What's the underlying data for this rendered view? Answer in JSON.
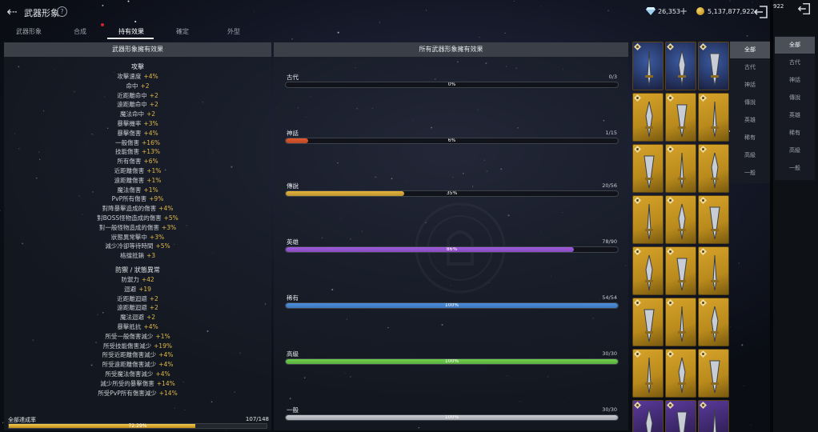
{
  "header": {
    "title": "武器形象",
    "help_icon": "?",
    "back_icon": "back-arrow-icon",
    "gems": "26,353",
    "gem_plus": "+",
    "gold": "5,137,877,922",
    "top_right_number": "922"
  },
  "tabs": [
    {
      "label": "武器形象"
    },
    {
      "label": "合成"
    },
    {
      "label": "持有效果"
    },
    {
      "label": "確定"
    },
    {
      "label": "外型"
    }
  ],
  "left_panel": {
    "header": "武器形象擁有效果",
    "sections": [
      {
        "title": "攻擊",
        "stats": [
          {
            "name": "攻擊速度",
            "value": "+4%"
          },
          {
            "name": "命中",
            "value": "+2"
          },
          {
            "name": "近距離命中",
            "value": "+2"
          },
          {
            "name": "遠距離命中",
            "value": "+2"
          },
          {
            "name": "魔法命中",
            "value": "+2"
          },
          {
            "name": "暴擊機率",
            "value": "+3%"
          },
          {
            "name": "暴擊傷害",
            "value": "+4%"
          },
          {
            "name": "一般傷害",
            "value": "+16%"
          },
          {
            "name": "技能傷害",
            "value": "+13%"
          },
          {
            "name": "所有傷害",
            "value": "+6%"
          },
          {
            "name": "近距離傷害",
            "value": "+1%"
          },
          {
            "name": "遠距離傷害",
            "value": "+1%"
          },
          {
            "name": "魔法傷害",
            "value": "+1%"
          },
          {
            "name": "PvP所有傷害",
            "value": "+9%"
          },
          {
            "name": "對降暴擊造成的傷害",
            "value": "+4%"
          },
          {
            "name": "對BOSS怪物造成的傷害",
            "value": "+5%"
          },
          {
            "name": "對一般怪物造成的傷害",
            "value": "+3%"
          },
          {
            "name": "狀態異常擊中",
            "value": "+3%"
          },
          {
            "name": "減少冷卻等待時間",
            "value": "+5%"
          },
          {
            "name": "格擋抵銷",
            "value": "+3"
          }
        ]
      },
      {
        "title": "防禦 / 狀態異常",
        "stats": [
          {
            "name": "防禦力",
            "value": "+42"
          },
          {
            "name": "迴避",
            "value": "+19"
          },
          {
            "name": "近距離迴避",
            "value": "+2"
          },
          {
            "name": "遠距離迴避",
            "value": "+2"
          },
          {
            "name": "魔法迴避",
            "value": "+2"
          },
          {
            "name": "暴擊抵抗",
            "value": "+4%"
          },
          {
            "name": "所受一般傷害減少",
            "value": "+1%"
          },
          {
            "name": "所受技能傷害減少",
            "value": "+19%"
          },
          {
            "name": "所受近距離傷害減少",
            "value": "+4%"
          },
          {
            "name": "所受遠距離傷害減少",
            "value": "+4%"
          },
          {
            "name": "所受魔法傷害減少",
            "value": "+4%"
          },
          {
            "name": "減少所受的暴擊傷害",
            "value": "+14%"
          },
          {
            "name": "所受PvP所有傷害減少",
            "value": "+14%"
          }
        ]
      }
    ],
    "total": {
      "label": "全部達成率",
      "count": "107/148",
      "percent": "72.29%",
      "fraction": 0.7229
    }
  },
  "mid_panel": {
    "header": "所有武器形象擁有效果",
    "grades": [
      {
        "name": "古代",
        "count": "0/3",
        "pct": "0%",
        "fraction": 0.0,
        "color": "#7a7f88"
      },
      {
        "name": "神話",
        "count": "1/15",
        "pct": "6%",
        "fraction": 0.0667,
        "color": "#e2572b"
      },
      {
        "name": "傳說",
        "count": "20/56",
        "pct": "35%",
        "fraction": 0.357,
        "color": "#e6b43a"
      },
      {
        "name": "英雄",
        "count": "78/90",
        "pct": "86%",
        "fraction": 0.867,
        "color": "#a25be0"
      },
      {
        "name": "稀有",
        "count": "54/54",
        "pct": "100%",
        "fraction": 1.0,
        "color": "#4b8fe0"
      },
      {
        "name": "高級",
        "count": "30/30",
        "pct": "100%",
        "fraction": 1.0,
        "color": "#6fd24a"
      },
      {
        "name": "一般",
        "count": "30/30",
        "pct": "100%",
        "fraction": 1.0,
        "color": "#c9ccd2"
      }
    ]
  },
  "grid": {
    "rows": [
      "mythic",
      "legend",
      "legend",
      "legend",
      "legend",
      "legend",
      "legend",
      "hero"
    ],
    "colors": {
      "mythic": "#2b3a6b",
      "legend": "#b98a1c",
      "hero": "#3a2a6a"
    }
  },
  "filter1": {
    "items": [
      "全部",
      "古代",
      "神話",
      "傳說",
      "英雄",
      "稀有",
      "高級",
      "一般"
    ],
    "active": 0
  },
  "filter2": {
    "items": [
      "全部",
      "古代",
      "神話",
      "傳說",
      "英雄",
      "稀有",
      "高級",
      "一般"
    ],
    "active": 0
  }
}
